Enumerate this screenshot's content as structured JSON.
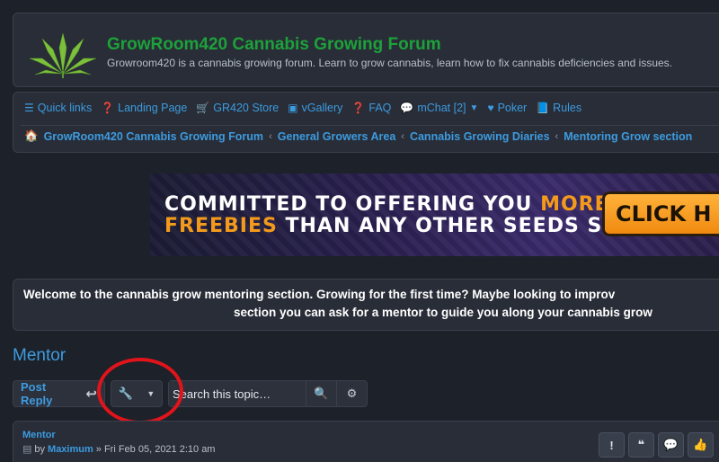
{
  "site": {
    "title": "GrowRoom420 Cannabis Growing Forum",
    "description": "Growroom420 is a cannabis growing forum. Learn to grow cannabis, learn how to fix cannabis deficiencies and issues."
  },
  "quick_links": [
    {
      "icon": "bars-icon",
      "label": "Quick links"
    },
    {
      "icon": "question-circle-icon",
      "label": "Landing Page"
    },
    {
      "icon": "cart-icon",
      "label": "GR420 Store"
    },
    {
      "icon": "image-gallery-icon",
      "label": "vGallery"
    },
    {
      "icon": "question-circle-icon",
      "label": "FAQ"
    },
    {
      "icon": "chat-icon",
      "label": "mChat [2]"
    },
    {
      "icon": "heart-icon",
      "label": "Poker"
    },
    {
      "icon": "book-icon",
      "label": "Rules"
    }
  ],
  "breadcrumbs": [
    "GrowRoom420 Cannabis Growing Forum",
    "General Growers Area",
    "Cannabis Growing Diaries",
    "Mentoring Grow section"
  ],
  "banner": {
    "line1_white": "COMMITTED TO OFFERING YOU ",
    "line1_orange": "MORE",
    "line2_orange": "FREEBIES",
    "line2_white": " THAN ANY OTHER SEEDS SITE",
    "cta": "CLICK H"
  },
  "welcome": {
    "line1": "Welcome to the cannabis grow mentoring section. Growing for the first time? Maybe looking to improv",
    "line2": "section you can ask for a mentor to guide you along your cannabis grow"
  },
  "topic": {
    "title": "Mentor",
    "post_reply_label": "Post Reply",
    "search_placeholder": "Search this topic…"
  },
  "post": {
    "title": "Mentor",
    "by_label": "by",
    "author": "Maximum",
    "date": "» Fri Feb 05, 2021 2:10 am"
  },
  "colors": {
    "accent": "#3d9be0",
    "site_title": "#1da13a",
    "highlight_circle": "#e0141a"
  }
}
